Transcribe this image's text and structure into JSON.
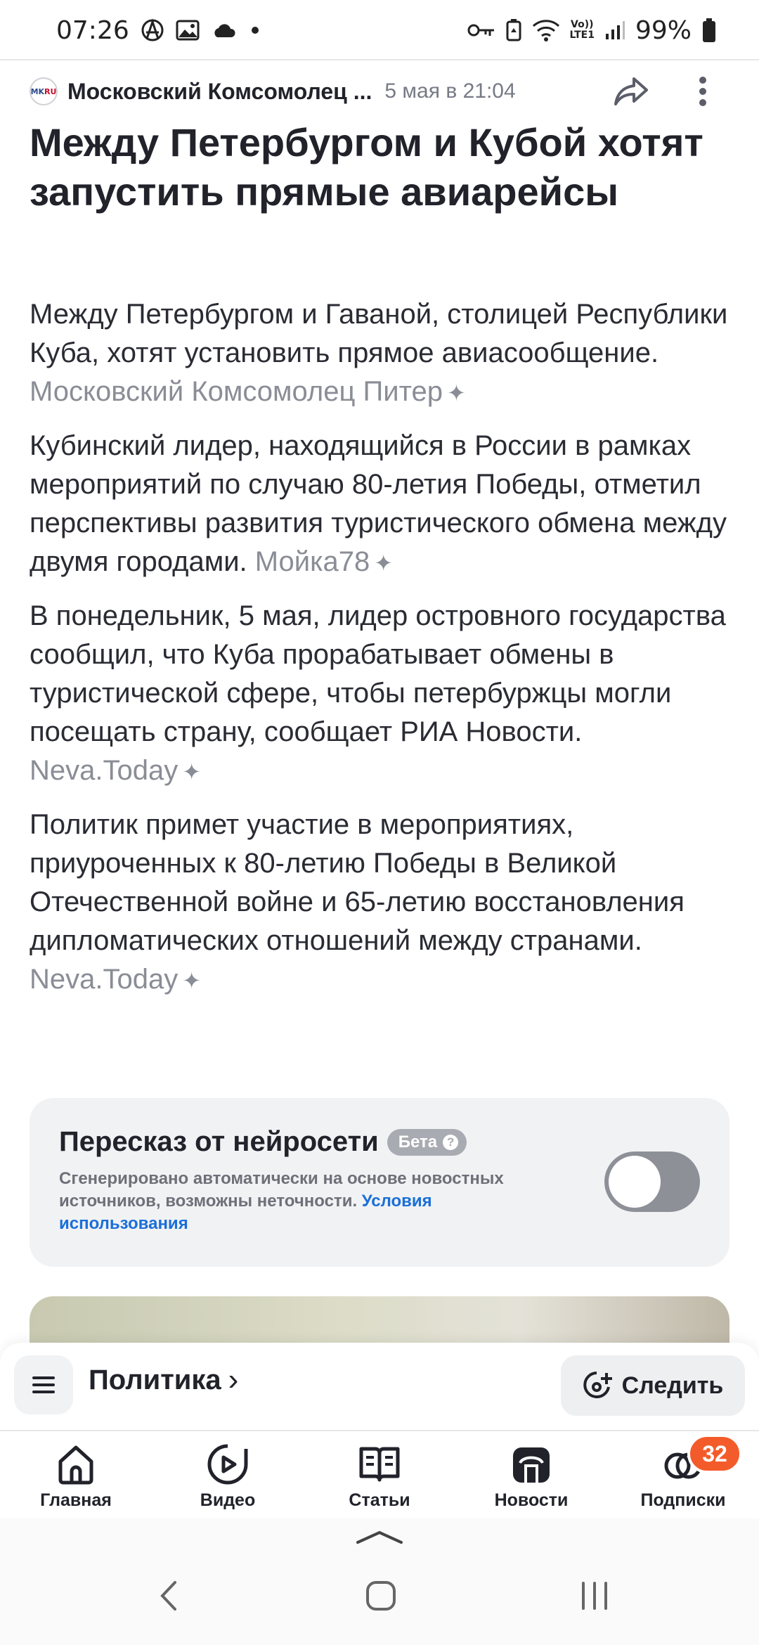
{
  "status_bar": {
    "time": "07:26",
    "battery": "99%",
    "network_label": "LTE1",
    "volte_label": "Vo))"
  },
  "source": {
    "logo_text_a": "MK",
    "logo_text_b": "RU",
    "name": "Московский Комсомолец ...",
    "date": "5 мая в 21:04"
  },
  "article": {
    "headline": "Между Петербургом и Кубой хотят запустить прямые авиарейсы",
    "paragraphs": [
      {
        "text": "Между Петербургом и Гаваной, столицей Республики Куба, хотят установить прямое авиасообщение. ",
        "source": "Московский Комсомолец Питер"
      },
      {
        "text": "Кубинский лидер, находящийся в России в рамках мероприятий по случаю 80-летия Победы, отметил перспективы развития туристического обмена между двумя городами. ",
        "source": "Мойка78"
      },
      {
        "text": "В понедельник, 5 мая, лидер островного государства сообщил, что Куба прорабатывает обмены в туристической сфере, чтобы петербуржцы могли посещать страну, сообщает РИА Новости. ",
        "source": "Neva.Today"
      },
      {
        "text": "Политик примет участие в мероприятиях, приуроченных к 80-летию Победы в Великой Отечественной войне и 65-летию восстановления дипломатических отношений между странами. ",
        "source": "Neva.Today"
      }
    ]
  },
  "ai_card": {
    "title": "Пересказ от нейросети",
    "badge": "Бета",
    "badge_icon": "?",
    "description": "Сгенерировано автоматически на основе новостных источников, возможны неточности. ",
    "link": "Условия использования",
    "toggle_on": false
  },
  "rubric": {
    "label": "Политика",
    "chevron": "›",
    "follow": "Следить"
  },
  "tabs": [
    {
      "label": "Главная",
      "icon": "home-icon"
    },
    {
      "label": "Видео",
      "icon": "video-icon"
    },
    {
      "label": "Статьи",
      "icon": "articles-icon"
    },
    {
      "label": "Новости",
      "icon": "news-icon"
    },
    {
      "label": "Подписки",
      "icon": "subscriptions-icon",
      "badge": "32"
    }
  ],
  "colors": {
    "accent_link": "#1a6fd8",
    "badge": "#f45b2a",
    "card_bg": "#f1f2f4",
    "toggle_off": "#8e9098"
  }
}
